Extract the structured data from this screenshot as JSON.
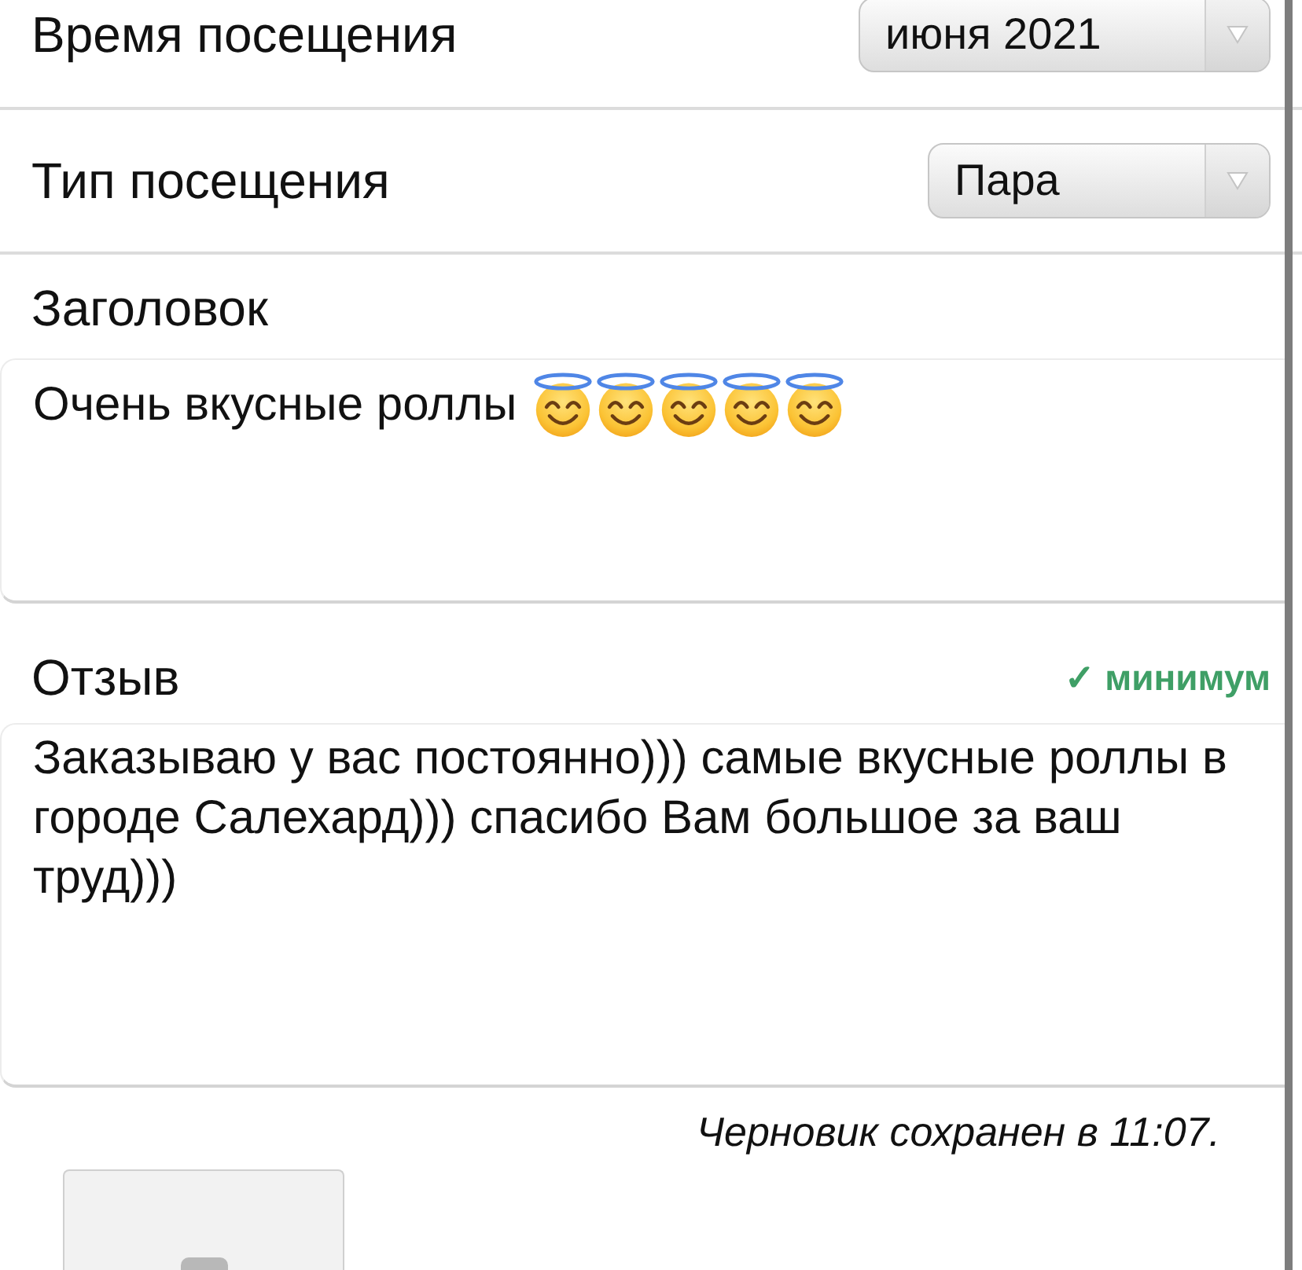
{
  "fields": [
    {
      "kind": "select",
      "label": "Время посещения",
      "value": "июня 2021"
    },
    {
      "kind": "select",
      "label": "Тип посещения",
      "value": "Пара"
    }
  ],
  "title_section": {
    "label": "Заголовок",
    "value": "Очень вкусные роллы",
    "emoji": [
      {
        "kind": "smiling-face-with-halo"
      },
      {
        "kind": "smiling-face-with-halo"
      },
      {
        "kind": "smiling-face-with-halo"
      },
      {
        "kind": "smiling-face-with-halo"
      },
      {
        "kind": "smiling-face-with-halo"
      }
    ]
  },
  "review_section": {
    "label": "Отзыв",
    "validation": "✓ минимум",
    "value": "Заказываю у вас постоянно))) самые вкусные роллы в городе Салехард))) спасибо Вам большое за ваш труд)))"
  },
  "draft_status": "Черновик сохранен в 11:07."
}
